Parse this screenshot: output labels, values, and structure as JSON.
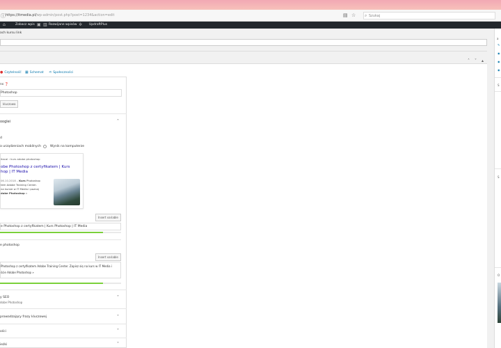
{
  "browser": {
    "url_prefix": "https://itmedia.pl/",
    "url_rest": "wp-admin/post.php?post=1234&action=edit",
    "search_placeholder": "Szukaj"
  },
  "adminbar": {
    "items": [
      "Zobacz wpis",
      "Rozwijane wpisów",
      "UpdraftPlus"
    ]
  },
  "permalink": {
    "title": "ach kursu link"
  },
  "tabs": [
    {
      "label": "Czytelność",
      "icon": "readability-icon"
    },
    {
      "label": "Schemat",
      "icon": "schema-icon"
    },
    {
      "label": "Społeczności",
      "icon": "social-icon"
    }
  ],
  "seo": {
    "focus_label": "ns",
    "focus_value": "Photoshop",
    "related_button": "kluczowa",
    "snippet_section": "ooglei",
    "preview_label": "d",
    "mobile_option": "a urządzeniach mobilnych",
    "desktop_option": "Wynik na komputerze",
    "url_line": "itacal › kurs adobe photoshop",
    "snippet_title": "obe Photoshop z certyfikatem | Kurs\nhop | IT Media",
    "snippet_date": "06.10.2018 – ",
    "snippet_bold1": "Kurs",
    "snippet_desc1": " Photoshop",
    "snippet_desc2": "tem Adobe Training Center.",
    "snippet_desc3": "na kursie w IT Media i poznaj",
    "snippet_bold2": "dobe Photoshop",
    "insert_variable": "Insert variable",
    "seo_title_value": "e Photoshop z certyfikatem | Kurs Photoshop | IT Media",
    "meta_label": "e photoshop",
    "meta_value": "Photoshop z certyfikatem Adobe Training Center. Zapisz się na kurs w IT Media i",
    "meta_value2": "ście Adobe Photoshop »",
    "title_progress": 0.85,
    "meta_progress": 0.85
  },
  "collapsed": [
    {
      "title": "y SEO",
      "subtitle": "dobe Photoshop"
    },
    {
      "title": "prowadzający frazy kluczowej",
      "subtitle": ""
    },
    {
      "title": "ości",
      "subtitle": ""
    },
    {
      "title": "ieżki",
      "subtitle": ""
    }
  ],
  "sidebar_marks": [
    "a",
    "S",
    "S",
    "O"
  ]
}
